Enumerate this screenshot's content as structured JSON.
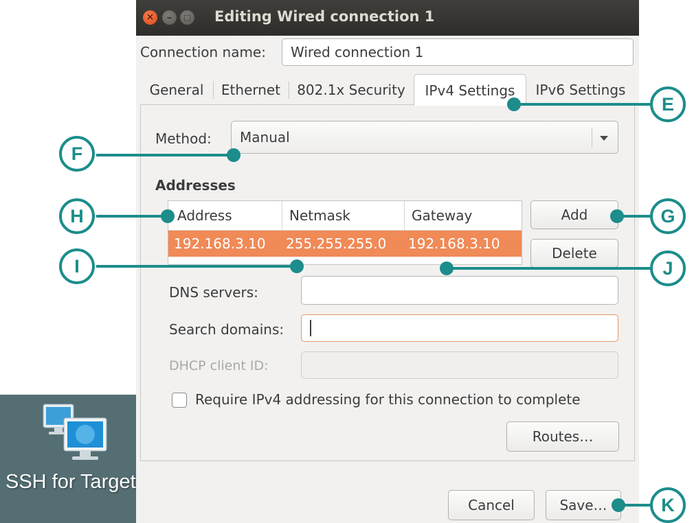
{
  "window": {
    "title": "Editing Wired connection 1",
    "buttons": [
      "close",
      "minimize",
      "maximize"
    ]
  },
  "connection_name": {
    "label": "Connection name:",
    "value": "Wired connection 1"
  },
  "tabs": [
    {
      "label": "General",
      "active": false
    },
    {
      "label": "Ethernet",
      "active": false
    },
    {
      "label": "802.1x Security",
      "active": false
    },
    {
      "label": "IPv4 Settings",
      "active": true
    },
    {
      "label": "IPv6 Settings",
      "active": false
    }
  ],
  "method": {
    "label": "Method:",
    "value": "Manual"
  },
  "addresses": {
    "heading": "Addresses",
    "columns": [
      "Address",
      "Netmask",
      "Gateway"
    ],
    "rows": [
      {
        "address": "192.168.3.10",
        "netmask": "255.255.255.0",
        "gateway": "192.168.3.10",
        "selected": true
      }
    ],
    "add_label": "Add",
    "delete_label": "Delete"
  },
  "dns_servers": {
    "label": "DNS servers:",
    "value": ""
  },
  "search_domains": {
    "label": "Search domains:",
    "value": ""
  },
  "dhcp_client_id": {
    "label": "DHCP client ID:",
    "value": "",
    "disabled": true
  },
  "require_ipv4": {
    "label": "Require IPv4 addressing for this connection to complete",
    "checked": false
  },
  "routes_label": "Routes…",
  "footer": {
    "cancel_label": "Cancel",
    "save_label": "Save…"
  },
  "desktop_icon": {
    "label": "SSH for Target",
    "icon": "network-computers-icon"
  },
  "callouts": [
    "E",
    "F",
    "G",
    "H",
    "I",
    "J",
    "K"
  ],
  "colors": {
    "accent": "#f08a57",
    "callout": "#1c8d8b",
    "close_button": "#df4b16",
    "titlebar": "#35342f"
  }
}
